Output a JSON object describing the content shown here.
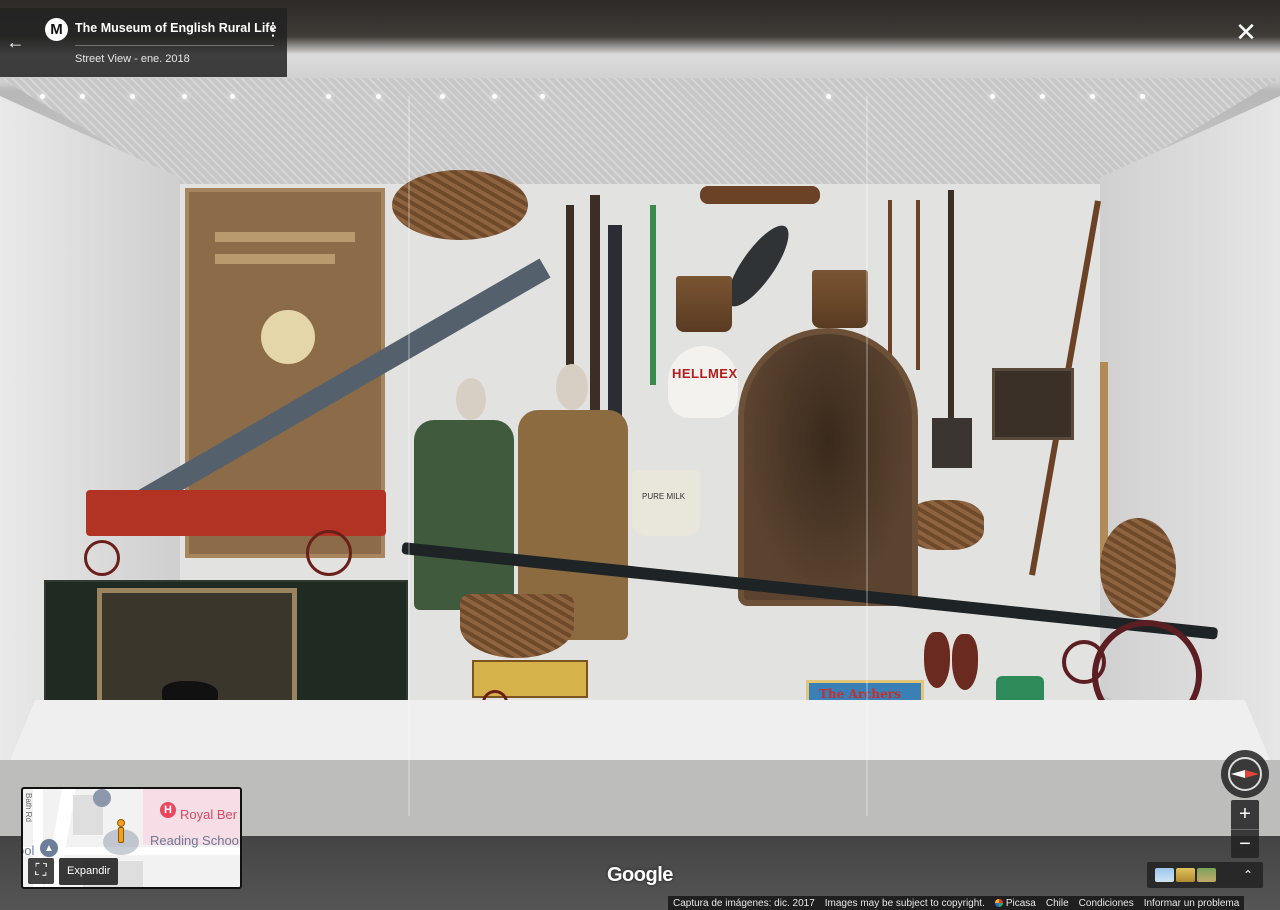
{
  "place": {
    "logo_letter": "M",
    "title": "The Museum of English Rural Life",
    "subtitle": "Street View - ene. 2018"
  },
  "controls": {
    "back_glyph": "←",
    "menu_glyph": "⋮",
    "close_glyph": "✕",
    "zoom_in": "+",
    "zoom_out": "−",
    "expand_tooltip": "Expandir",
    "expand_glyph": "⛶",
    "thumbnails_toggle_glyph": "⌃"
  },
  "minimap": {
    "hospital_label": "Royal Ber",
    "school_label": "Reading Schoo",
    "school_label_left": "ool",
    "road_label": "Bath Rd",
    "pin_letter": "H"
  },
  "scene_text": {
    "shell_sign": "HELLMEX",
    "book_title": "The Archers",
    "pot_text": "PURE MILK"
  },
  "branding": {
    "google": "Google"
  },
  "footer": {
    "capture_date": "Captura de imágenes: dic. 2017",
    "copyright": "Images may be subject to copyright.",
    "contributor": "Picasa",
    "country": "Chile",
    "terms": "Condiciones",
    "report": "Informar un problema"
  },
  "colors": {
    "overlay_bg": "#222222",
    "compass_north": "#e0443a",
    "hospital_red": "#e7465c"
  }
}
